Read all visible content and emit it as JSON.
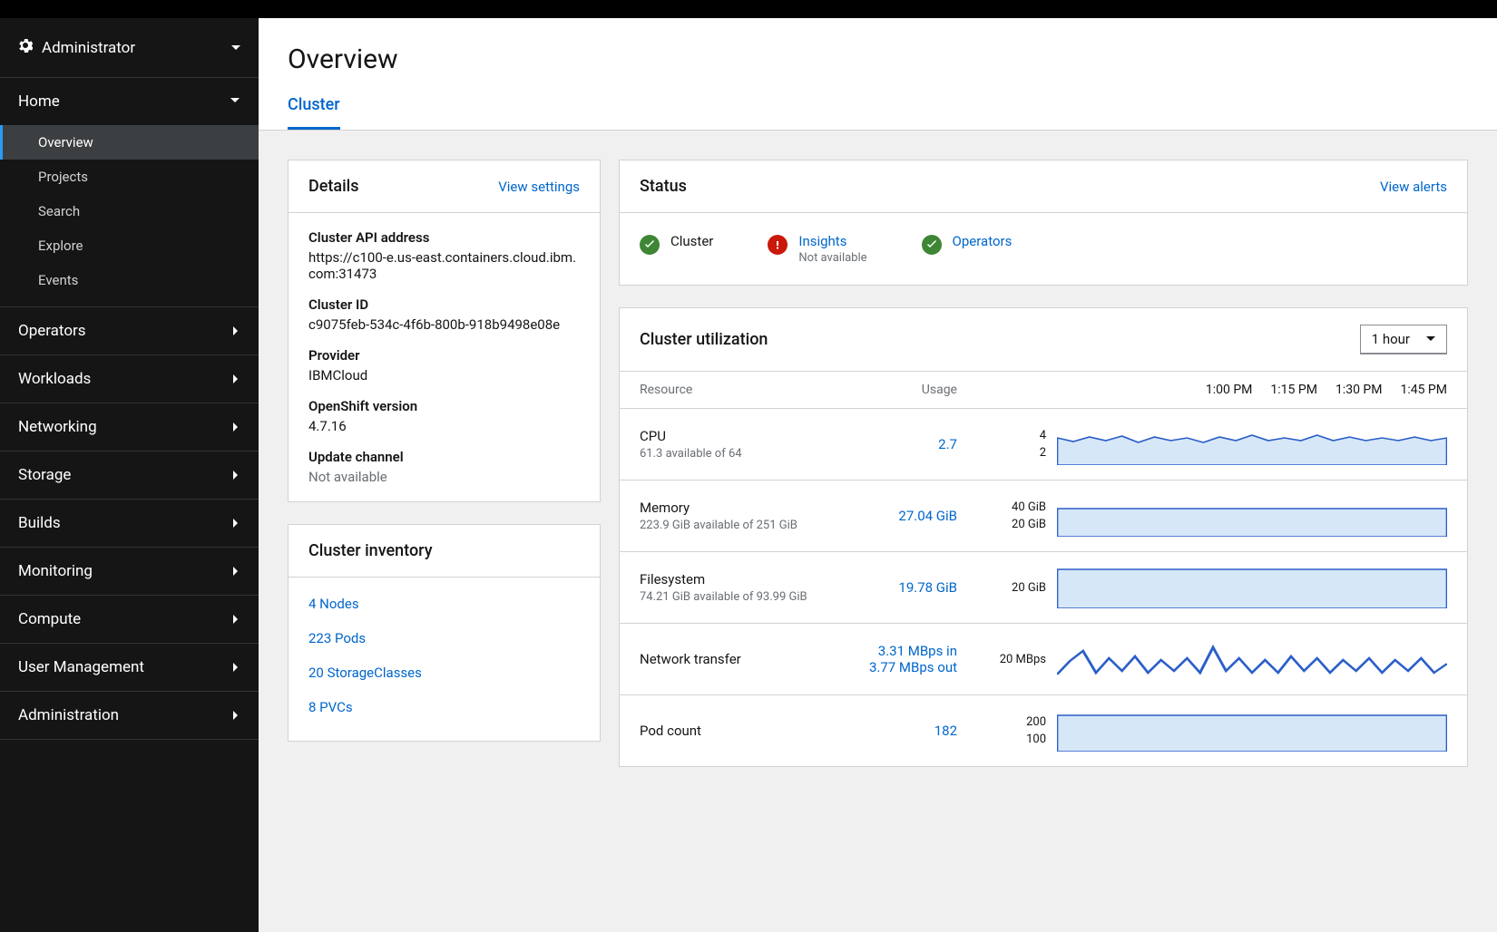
{
  "perspective": {
    "label": "Administrator"
  },
  "nav": {
    "home": {
      "label": "Home",
      "items": [
        "Overview",
        "Projects",
        "Search",
        "Explore",
        "Events"
      ]
    },
    "sections": [
      "Operators",
      "Workloads",
      "Networking",
      "Storage",
      "Builds",
      "Monitoring",
      "Compute",
      "User Management",
      "Administration"
    ]
  },
  "page": {
    "title": "Overview",
    "tab": "Cluster"
  },
  "details": {
    "title": "Details",
    "link": "View settings",
    "items": [
      {
        "label": "Cluster API address",
        "value": "https://c100-e.us-east.containers.cloud.ibm.com:31473"
      },
      {
        "label": "Cluster ID",
        "value": "c9075feb-534c-4f6b-800b-918b9498e08e"
      },
      {
        "label": "Provider",
        "value": "IBMCloud"
      },
      {
        "label": "OpenShift version",
        "value": "4.7.16"
      },
      {
        "label": "Update channel",
        "value": "Not available",
        "muted": true
      }
    ]
  },
  "inventory": {
    "title": "Cluster inventory",
    "items": [
      "4 Nodes",
      "223 Pods",
      "20 StorageClasses",
      "8 PVCs"
    ]
  },
  "status": {
    "title": "Status",
    "link": "View alerts",
    "items": [
      {
        "label": "Cluster",
        "link": false,
        "state": "ok"
      },
      {
        "label": "Insights",
        "link": true,
        "sub": "Not available",
        "state": "warn"
      },
      {
        "label": "Operators",
        "link": true,
        "state": "ok"
      }
    ]
  },
  "utilization": {
    "title": "Cluster utilization",
    "range": "1 hour",
    "header": {
      "resource": "Resource",
      "usage": "Usage"
    },
    "ticks": [
      "1:00 PM",
      "1:15 PM",
      "1:30 PM",
      "1:45 PM"
    ],
    "rows": [
      {
        "name": "CPU",
        "sub": "61.3 available of 64",
        "usage": "2.7",
        "ylabels": [
          "4",
          "2"
        ]
      },
      {
        "name": "Memory",
        "sub": "223.9 GiB available of 251 GiB",
        "usage": "27.04 GiB",
        "ylabels": [
          "40 GiB",
          "20 GiB"
        ]
      },
      {
        "name": "Filesystem",
        "sub": "74.21 GiB available of 93.99 GiB",
        "usage": "19.78 GiB",
        "ylabels": [
          "20 GiB"
        ]
      },
      {
        "name": "Network transfer",
        "usage": "3.31 MBps in",
        "usage2": "3.77 MBps out",
        "ylabels": [
          "20 MBps"
        ]
      },
      {
        "name": "Pod count",
        "usage": "182",
        "ylabels": [
          "200",
          "100"
        ]
      }
    ]
  },
  "chart_data": [
    {
      "type": "area",
      "title": "CPU",
      "ylim": [
        0,
        4
      ],
      "x": [
        "1:00 PM",
        "1:15 PM",
        "1:30 PM",
        "1:45 PM"
      ],
      "values_approx": [
        2.8,
        2.6,
        2.9,
        2.7,
        3.0,
        2.6,
        2.9,
        2.7,
        2.8,
        2.6,
        2.9,
        2.7,
        3.0,
        2.7,
        2.8,
        2.7,
        3.0,
        2.7,
        2.9,
        2.7,
        2.8,
        2.7,
        2.9,
        2.7
      ]
    },
    {
      "type": "area",
      "title": "Memory",
      "unit": "GiB",
      "ylim": [
        0,
        40
      ],
      "x": [
        "1:00 PM",
        "1:15 PM",
        "1:30 PM",
        "1:45 PM"
      ],
      "values_approx": [
        27,
        27,
        27,
        27,
        27,
        27,
        27,
        27,
        27,
        27,
        27,
        27,
        27,
        27,
        27,
        27,
        27,
        27,
        27,
        27,
        27,
        27,
        27,
        27
      ]
    },
    {
      "type": "area",
      "title": "Filesystem",
      "unit": "GiB",
      "ylim": [
        0,
        20
      ],
      "x": [
        "1:00 PM",
        "1:15 PM",
        "1:30 PM",
        "1:45 PM"
      ],
      "values_approx": [
        19.8,
        19.8,
        19.8,
        19.8,
        19.8,
        19.8,
        19.8,
        19.8,
        19.8,
        19.8,
        19.8,
        19.8,
        19.8,
        19.8,
        19.8,
        19.8,
        19.8,
        19.8,
        19.8,
        19.8,
        19.8,
        19.8,
        19.8,
        19.8
      ]
    },
    {
      "type": "line",
      "title": "Network transfer",
      "unit": "MBps",
      "ylim": [
        0,
        20
      ],
      "x": [
        "1:00 PM",
        "1:15 PM",
        "1:30 PM",
        "1:45 PM"
      ],
      "series": [
        {
          "name": "in",
          "values_approx": [
            3,
            7,
            10,
            3,
            8,
            4,
            9,
            3,
            7,
            4,
            8,
            3,
            12,
            4,
            8,
            3,
            7,
            3,
            9,
            4,
            8,
            3,
            7,
            4
          ]
        },
        {
          "name": "out",
          "values_approx": [
            3,
            6,
            9,
            4,
            7,
            3,
            8,
            4,
            6,
            3,
            7,
            4,
            11,
            3,
            7,
            4,
            6,
            4,
            8,
            3,
            7,
            4,
            6,
            3
          ]
        }
      ]
    },
    {
      "type": "area",
      "title": "Pod count",
      "ylim": [
        0,
        200
      ],
      "x": [
        "1:00 PM",
        "1:15 PM",
        "1:30 PM",
        "1:45 PM"
      ],
      "values_approx": [
        182,
        182,
        182,
        182,
        182,
        182,
        182,
        182,
        182,
        182,
        182,
        182,
        182,
        182,
        182,
        182,
        182,
        182,
        182,
        182,
        182,
        182,
        182,
        182
      ]
    }
  ]
}
